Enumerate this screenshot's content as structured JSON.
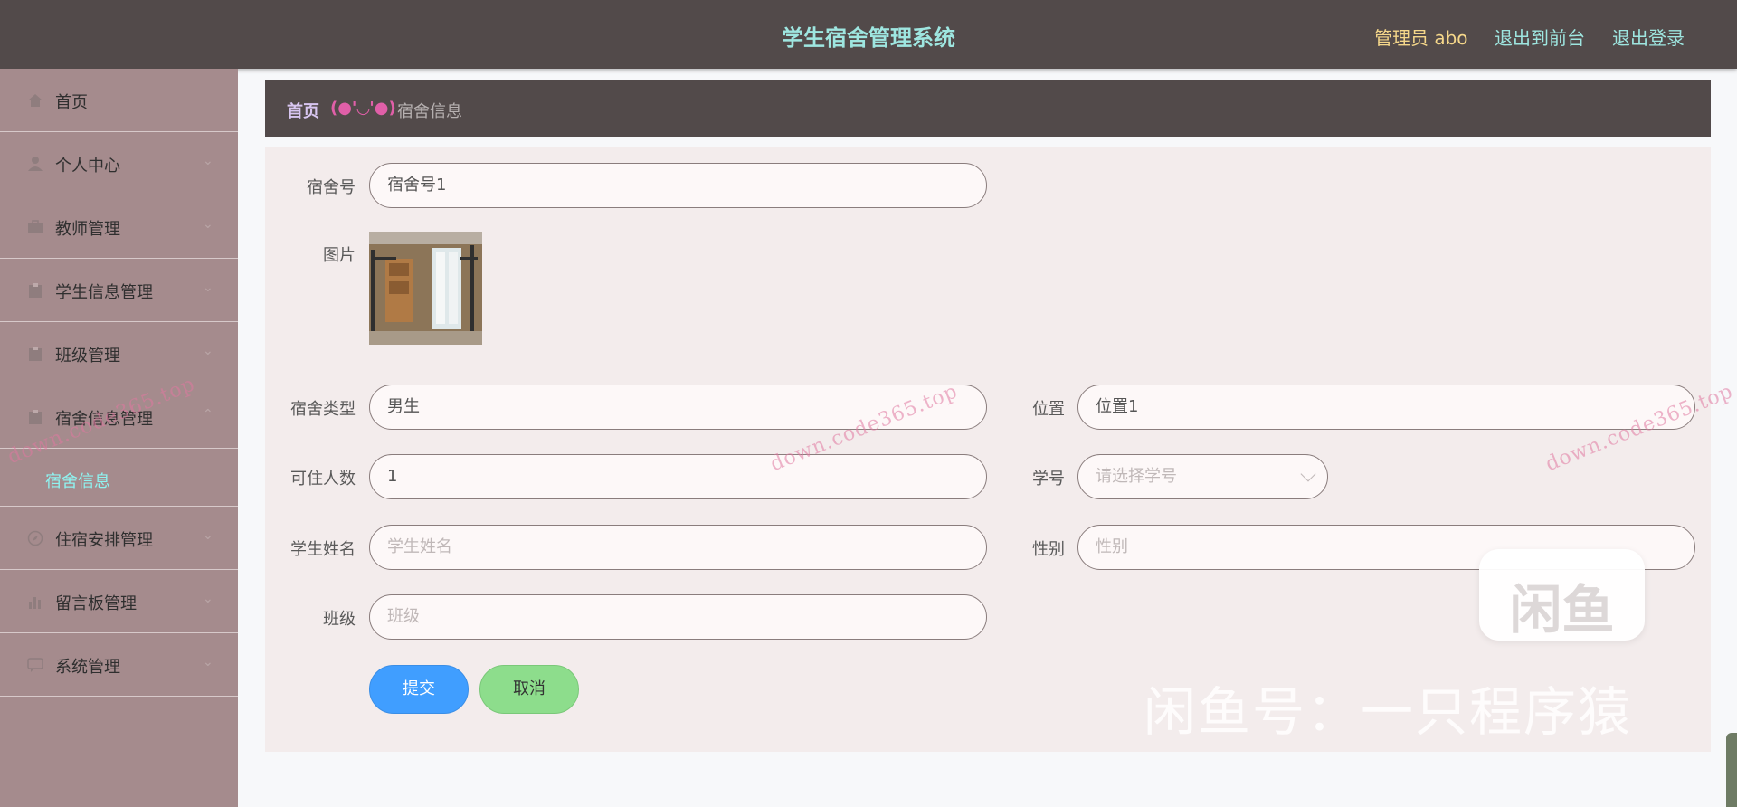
{
  "header": {
    "title": "学生宿舍管理系统",
    "admin_label": "管理员 abo",
    "front_label": "退出到前台",
    "logout_label": "退出登录"
  },
  "sidebar": {
    "items": [
      {
        "label": "首页",
        "icon": "home-icon"
      },
      {
        "label": "个人中心",
        "icon": "user-icon"
      },
      {
        "label": "教师管理",
        "icon": "briefcase-icon"
      },
      {
        "label": "学生信息管理",
        "icon": "clipboard-icon"
      },
      {
        "label": "班级管理",
        "icon": "clipboard-icon"
      },
      {
        "label": "宿舍信息管理",
        "icon": "clipboard-icon"
      },
      {
        "label": "住宿安排管理",
        "icon": "compass-icon"
      },
      {
        "label": "留言板管理",
        "icon": "bar-chart-icon"
      },
      {
        "label": "系统管理",
        "icon": "chat-icon"
      }
    ],
    "submenu_active": "宿舍信息"
  },
  "breadcrumb": {
    "home": "首页",
    "separator": "(●'◡'●)",
    "current": "宿舍信息"
  },
  "form": {
    "dorm_no_label": "宿舍号",
    "dorm_no_value": "宿舍号1",
    "photo_label": "图片",
    "dorm_type_label": "宿舍类型",
    "dorm_type_value": "男生",
    "location_label": "位置",
    "location_value": "位置1",
    "capacity_label": "可住人数",
    "capacity_value": "1",
    "student_no_label": "学号",
    "student_no_placeholder": "请选择学号",
    "student_name_label": "学生姓名",
    "student_name_placeholder": "学生姓名",
    "gender_label": "性别",
    "gender_placeholder": "性别",
    "class_label": "班级",
    "class_placeholder": "班级",
    "submit_label": "提交",
    "cancel_label": "取消"
  },
  "overlay": {
    "watermark_text": "down.code365.top",
    "logo_text": "闲鱼",
    "seller_text": "闲鱼号：一只程序猿"
  }
}
